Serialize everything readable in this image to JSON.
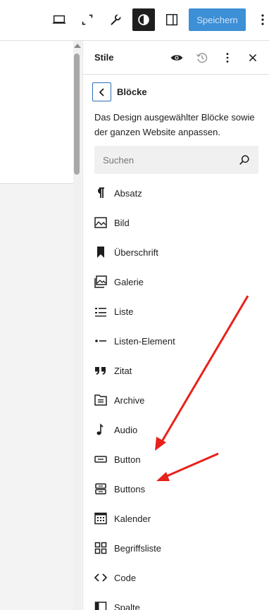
{
  "toolbar": {
    "save_label": "Speichern"
  },
  "sidebar": {
    "title": "Stile",
    "nav_title": "Blöcke",
    "description": "Das Design ausgewählter Blöcke sowie der ganzen Website anpassen.",
    "search_placeholder": "Suchen",
    "blocks": [
      {
        "label": "Absatz",
        "icon": "paragraph-icon"
      },
      {
        "label": "Bild",
        "icon": "image-icon"
      },
      {
        "label": "Überschrift",
        "icon": "heading-icon"
      },
      {
        "label": "Galerie",
        "icon": "gallery-icon"
      },
      {
        "label": "Liste",
        "icon": "list-icon"
      },
      {
        "label": "Listen-Element",
        "icon": "list-item-icon"
      },
      {
        "label": "Zitat",
        "icon": "quote-icon"
      },
      {
        "label": "Archive",
        "icon": "archive-icon"
      },
      {
        "label": "Audio",
        "icon": "audio-icon"
      },
      {
        "label": "Button",
        "icon": "button-icon"
      },
      {
        "label": "Buttons",
        "icon": "buttons-icon"
      },
      {
        "label": "Kalender",
        "icon": "calendar-icon"
      },
      {
        "label": "Begriffsliste",
        "icon": "terms-list-icon"
      },
      {
        "label": "Code",
        "icon": "code-icon"
      },
      {
        "label": "Spalte",
        "icon": "column-icon"
      }
    ]
  },
  "colors": {
    "accent": "#3d8fd6",
    "arrow": "#e8211b"
  }
}
